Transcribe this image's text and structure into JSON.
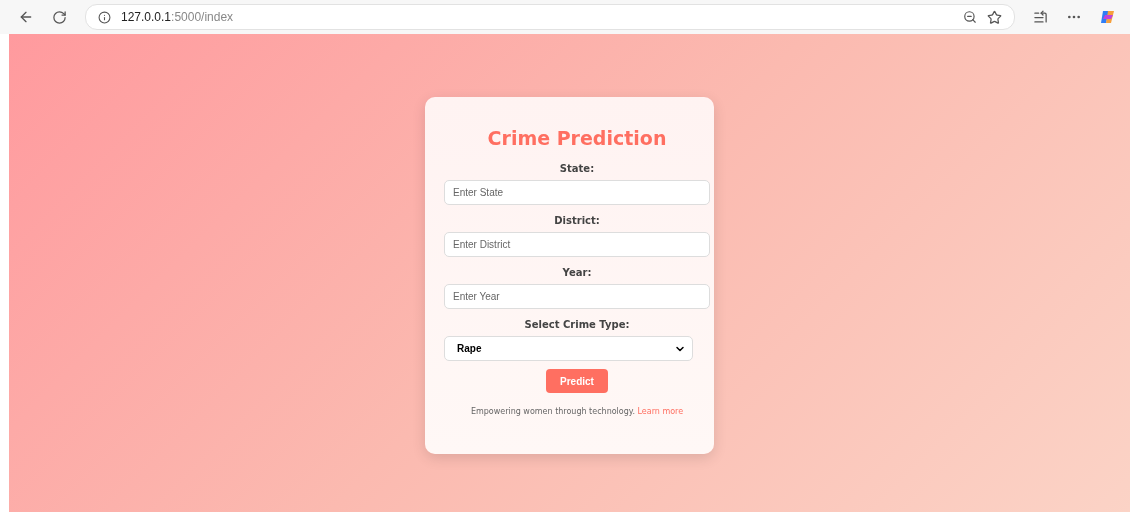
{
  "browser": {
    "url_host": "127.0.0.1",
    "url_path": ":5000/index"
  },
  "form": {
    "title": "Crime Prediction",
    "fields": [
      {
        "kind": "input",
        "label": "State:",
        "placeholder": "Enter State"
      },
      {
        "kind": "input",
        "label": "District:",
        "placeholder": "Enter District"
      },
      {
        "kind": "input",
        "label": "Year:",
        "placeholder": "Enter Year"
      },
      {
        "kind": "select",
        "label": "Select Crime Type:",
        "value": "Rape"
      }
    ],
    "button": "Predict",
    "footer": "Empowering women through technology.",
    "footer_link": "Learn more"
  }
}
